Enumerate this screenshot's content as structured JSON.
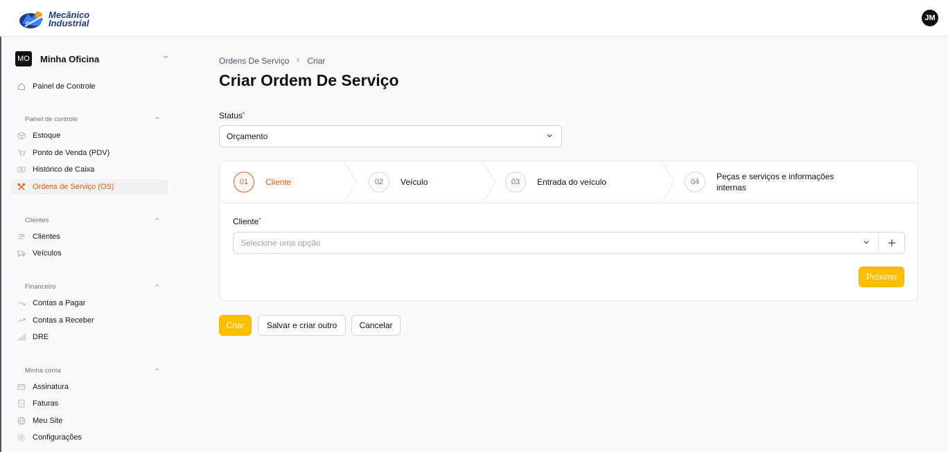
{
  "brand": {
    "logo_line1": "Mecânico",
    "logo_line2": "Industrial",
    "user_initials": "JM",
    "accent": "#ea580c",
    "primary": "#fbbf00"
  },
  "tenant": {
    "badge": "MO",
    "name": "Minha Oficina"
  },
  "sidebar": {
    "top_item": {
      "label": "Painel de Controle",
      "icon": "home-icon"
    },
    "sections": [
      {
        "label": "Painel de controle",
        "items": [
          {
            "label": "Estoque",
            "icon": "cube-icon"
          },
          {
            "label": "Ponto de Venda (PDV)",
            "icon": "cart-icon"
          },
          {
            "label": "Histórico de Caixa",
            "icon": "cash-icon"
          },
          {
            "label": "Ordens de Serviço (OS)",
            "icon": "tools-icon",
            "active": true
          }
        ]
      },
      {
        "label": "Clientes",
        "items": [
          {
            "label": "Clientes",
            "icon": "users-icon"
          },
          {
            "label": "Veículos",
            "icon": "truck-icon"
          }
        ]
      },
      {
        "label": "Financeiro",
        "items": [
          {
            "label": "Contas a Pagar",
            "icon": "trend-down-icon"
          },
          {
            "label": "Contas a Receber",
            "icon": "trend-up-icon"
          },
          {
            "label": "DRE",
            "icon": "bar-chart-icon"
          }
        ]
      },
      {
        "label": "Minha conta",
        "items": [
          {
            "label": "Assinatura",
            "icon": "credit-card-icon"
          },
          {
            "label": "Faturas",
            "icon": "document-icon"
          },
          {
            "label": "Meu Site",
            "icon": "globe-icon"
          },
          {
            "label": "Configurações",
            "icon": "gear-icon"
          }
        ]
      }
    ]
  },
  "breadcrumb": [
    "Ordens De Serviço",
    "Criar"
  ],
  "page_title": "Criar Ordem De Serviço",
  "status": {
    "label": "Status",
    "value": "Orçamento"
  },
  "steps": [
    {
      "num": "01",
      "label": "Cliente",
      "active": true
    },
    {
      "num": "02",
      "label": "Veículo"
    },
    {
      "num": "03",
      "label": "Entrada do veículo"
    },
    {
      "num": "04",
      "label_line1": "Peças e serviços e informações",
      "label_line2": "internas"
    }
  ],
  "cliente": {
    "label": "Cliente",
    "placeholder": "Selecione uma opção"
  },
  "buttons": {
    "next": "Próximo",
    "create": "Criar",
    "save_and_new": "Salvar e criar outro",
    "cancel": "Cancelar"
  }
}
